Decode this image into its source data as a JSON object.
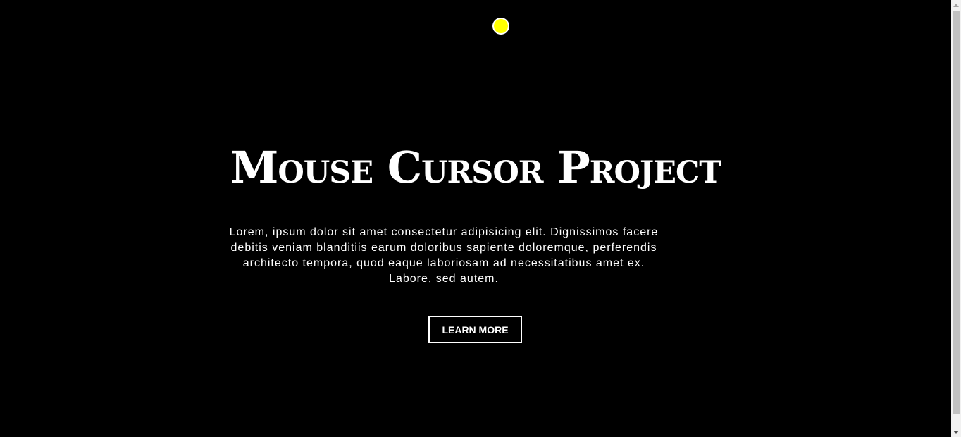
{
  "cursor": {
    "color": "#ffff00",
    "icon": "cursor-dot-icon"
  },
  "hero": {
    "title": "Mouse Cursor Project",
    "body_lines": [
      "Lorem, ipsum dolor sit amet consectetur adipisicing elit. Dignissimos facere",
      "debitis veniam blanditiis earum doloribus sapiente doloremque, perferendis",
      "architecto tempora, quod eaque laboriosam ad necessitatibus amet ex.",
      "Labore, sed autem."
    ],
    "button_label": "LEARN MORE"
  },
  "colors": {
    "background": "#000000",
    "text": "#ffffff"
  },
  "scrollbar": {
    "up_icon": "scroll-up-arrow-icon",
    "down_icon": "scroll-down-arrow-icon"
  }
}
